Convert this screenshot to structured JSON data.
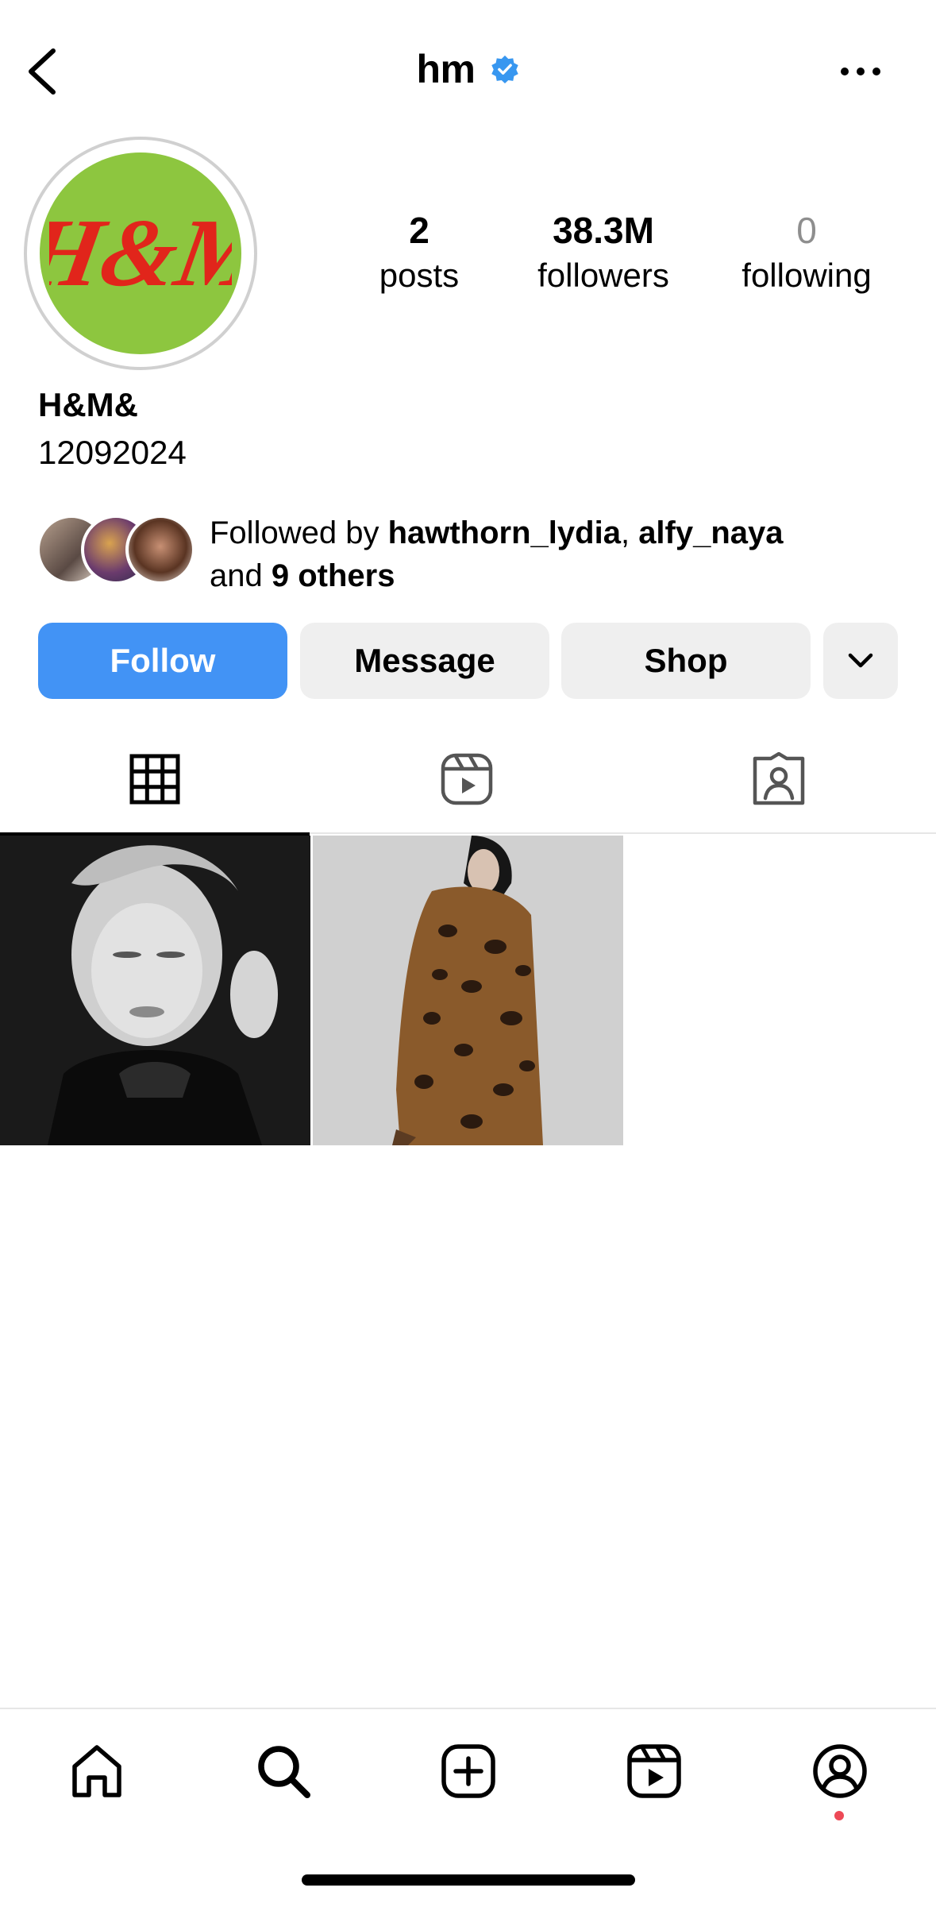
{
  "header": {
    "username": "hm",
    "verified": true
  },
  "profile": {
    "logo_text": "H&M",
    "logo_bg": "#8dc63f",
    "logo_color": "#e1251b",
    "display_name": "H&M&",
    "bio": "12092024"
  },
  "stats": {
    "posts": {
      "value": "2",
      "label": "posts"
    },
    "followers": {
      "value": "38.3M",
      "label": "followers"
    },
    "following": {
      "value": "0",
      "label": "following"
    }
  },
  "followed_by": {
    "prefix": "Followed by ",
    "user1": "hawthorn_lydia",
    "separator": ", ",
    "user2": "alfy_naya",
    "and_text": "and ",
    "others": "9 others"
  },
  "actions": {
    "follow": "Follow",
    "message": "Message",
    "shop": "Shop"
  },
  "colors": {
    "accent": "#4293f5",
    "verified": "#3897f0",
    "notification": "#ed4956"
  },
  "tabs": [
    {
      "icon": "grid-icon",
      "active": true
    },
    {
      "icon": "reels-icon",
      "active": false
    },
    {
      "icon": "tagged-icon",
      "active": false
    }
  ],
  "bottom_nav": [
    "home-icon",
    "search-icon",
    "create-icon",
    "reels-icon",
    "profile-icon"
  ]
}
